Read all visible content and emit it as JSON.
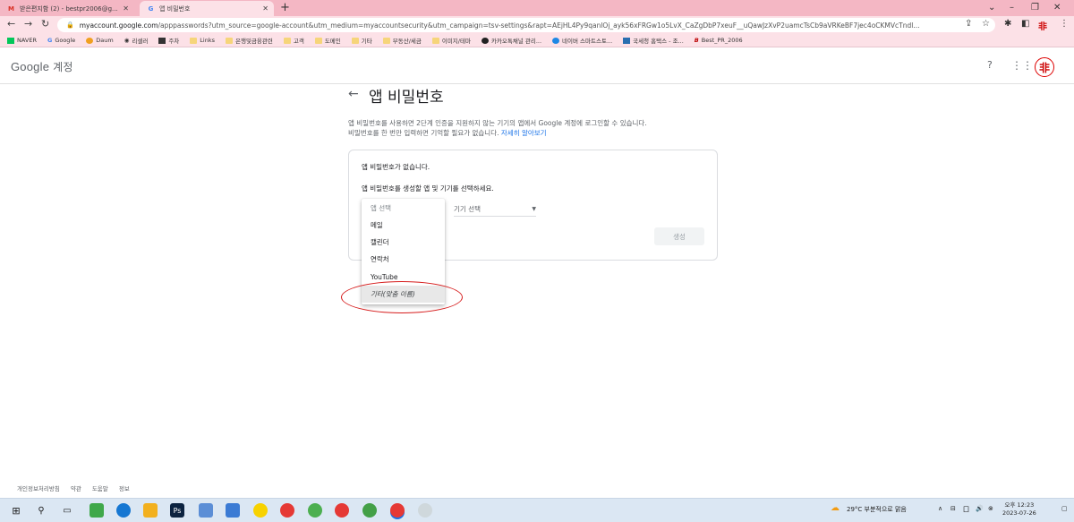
{
  "browser": {
    "tabs": [
      {
        "label": "받은편지함 (2) - bestpr2006@g...",
        "icon": "gmail-icon"
      },
      {
        "label": "앱 비밀번호",
        "icon": "google-icon"
      }
    ],
    "url_host": "myaccount.google.com",
    "url_path": "/apppasswords?utm_source=google-account&utm_medium=myaccountsecurity&utm_campaign=tsv-settings&rapt=AEjHL4Py9qanlOj_ayk56xFRGw1o5LvX_CaZgDbP7xeuF__uQawJzXvP2uamcTsCb9aVRKeBF7jec4oCKMVcTndl...",
    "bookmarks": [
      "NAVER",
      "Google",
      "Daum",
      "리셀러",
      "주차",
      "Links",
      "은행및금융관련",
      "고객",
      "도메인",
      "기타",
      "부동산/세금",
      "이미지/테마",
      "카카오톡채널 관리...",
      "네이버 스마트스토...",
      "국세청 홈택스 - 조...",
      "Best_PR_2006"
    ]
  },
  "header": {
    "logo_google": "Google",
    "logo_account": "계정",
    "avatar_glyph": "非"
  },
  "main": {
    "title": "앱 비밀번호",
    "desc_line1": "앱 비밀번호를 사용하면 2단계 인증을 지원하지 않는 기기의 앱에서 Google 계정에 로그인할 수 있습니다.",
    "desc_line2": "비밀번호를 한 번만 입력하면 기억할 필요가 없습니다.",
    "learn_more": "자세히 알아보기",
    "no_passwords": "앱 비밀번호가 없습니다.",
    "select_help": "앱 비밀번호를 생성할 앱 및 기기를 선택하세요.",
    "device_select": "기기 선택",
    "generate_button": "생성"
  },
  "app_menu": {
    "placeholder": "앱 선택",
    "items": [
      "메일",
      "캘린더",
      "연락처",
      "YouTube",
      "기타(맞춤 이름)"
    ],
    "selected": "기타(맞춤 이름)"
  },
  "footer": {
    "links": [
      "개인정보처리방침",
      "약관",
      "도움말",
      "정보"
    ]
  },
  "taskbar": {
    "weather": "29°C 부분적으로 맑음",
    "time": "오후 12:23",
    "date": "2023-07-26"
  },
  "colors": {
    "browser_chrome": "#f4b7c4",
    "link": "#1a73e8",
    "highlight_ellipse": "#d61c1c"
  }
}
